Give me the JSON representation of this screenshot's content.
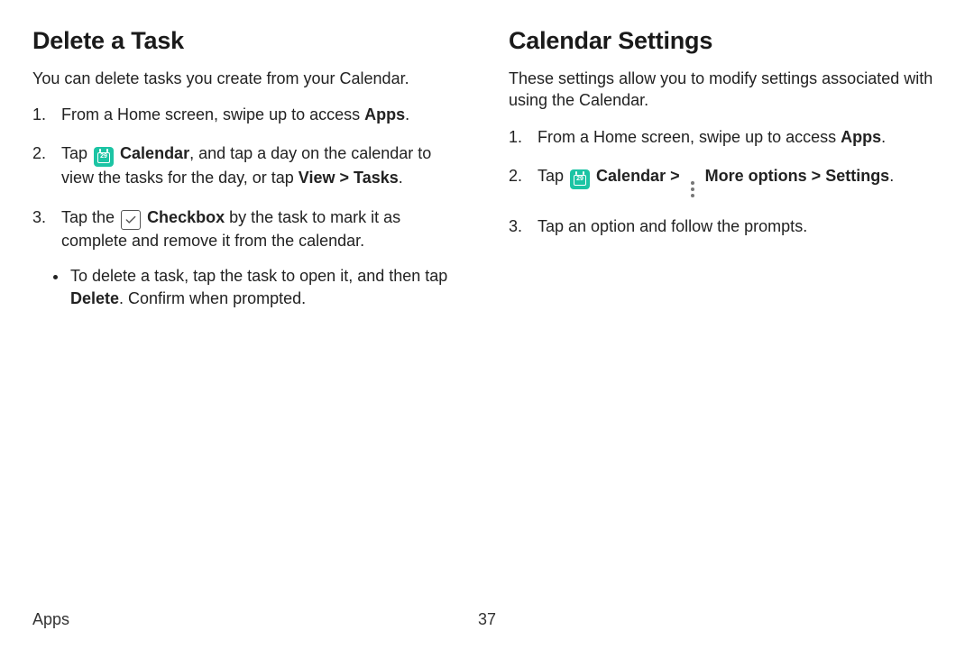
{
  "left": {
    "heading": "Delete a Task",
    "intro": "You can delete tasks you create from your Calendar.",
    "step1_a": "From a Home screen, swipe up to access ",
    "step1_b": "Apps",
    "step1_c": ".",
    "step2_a": "Tap ",
    "step2_b": "Calendar",
    "step2_c": ", and tap a day on the calendar to view the tasks for the day, or tap ",
    "step2_d": "View",
    "step2_e": "Tasks",
    "step2_f": ".",
    "step3_a": "Tap the ",
    "step3_b": "Checkbox",
    "step3_c": " by the task to mark it as complete and remove it from the calendar.",
    "bullet_a": "To delete a task, tap the task to open it, and then tap ",
    "bullet_b": "Delete",
    "bullet_c": ". Confirm when prompted.",
    "cal_icon_num": "29",
    "chevron": ">"
  },
  "right": {
    "heading": "Calendar Settings",
    "intro": "These settings allow you to modify settings associated with using the Calendar.",
    "step1_a": "From a Home screen, swipe up to access ",
    "step1_b": "Apps",
    "step1_c": ".",
    "step2_a": "Tap ",
    "step2_b": "Calendar",
    "step2_c": "More options",
    "step2_d": "Settings",
    "step2_e": ".",
    "step3": "Tap an option and follow the prompts.",
    "cal_icon_num": "29",
    "chevron": ">"
  },
  "footer": {
    "section": "Apps",
    "page": "37"
  }
}
